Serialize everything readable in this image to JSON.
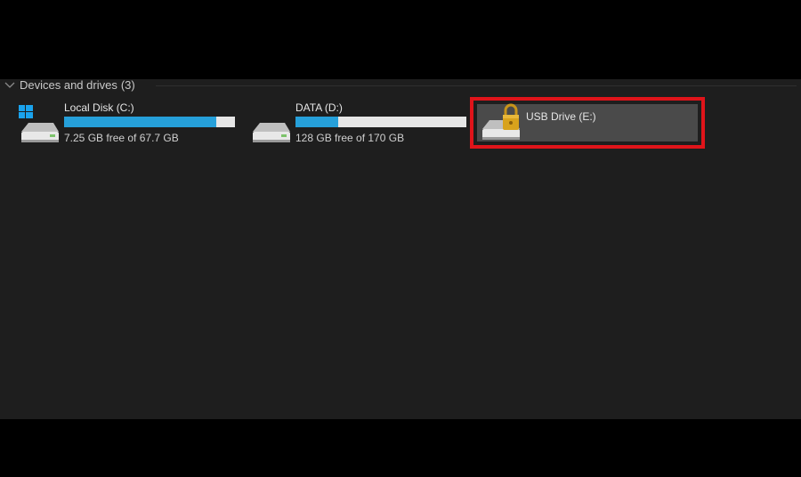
{
  "group": {
    "title": "Devices and drives",
    "count": "(3)"
  },
  "drives": [
    {
      "name": "Local Disk (C:)",
      "free_text": "7.25 GB free of 67.7 GB",
      "used_fraction": 0.89,
      "icon": "windows-system-drive-icon"
    },
    {
      "name": "DATA (D:)",
      "free_text": "128 GB free of 170 GB",
      "used_fraction": 0.25,
      "icon": "hard-drive-icon"
    },
    {
      "name": "USB Drive (E:)",
      "icon": "locked-drive-icon",
      "selected": true
    }
  ],
  "colors": {
    "bar_fill": "#26a0da",
    "bar_track": "#e6e6e6",
    "highlight_border": "#e0141a",
    "selection_background": "#4a4a4a",
    "lock": "#d8a21c"
  }
}
